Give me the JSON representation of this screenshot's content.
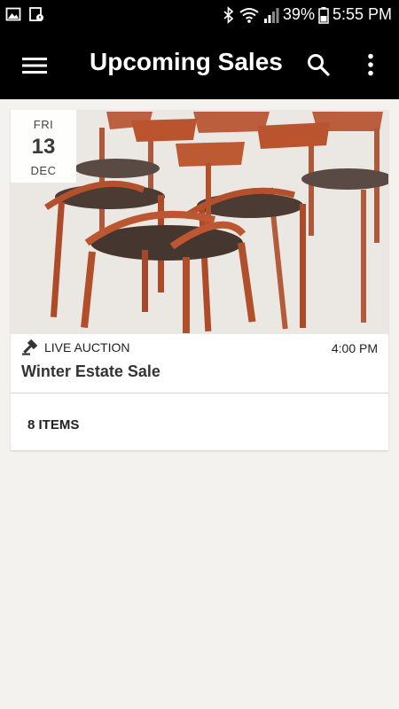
{
  "status_bar": {
    "battery": "39%",
    "time": "5:55 PM",
    "left_icons": [
      "image-icon",
      "calendar-notification-icon"
    ],
    "right_icons": [
      "bluetooth-icon",
      "wifi-icon",
      "signal-icon",
      "battery-icon"
    ]
  },
  "app_bar": {
    "title": "Upcoming Sales",
    "icons": [
      "menu-icon",
      "search-icon",
      "more-vert-icon"
    ]
  },
  "sales": [
    {
      "date": {
        "day_of_week": "FRI",
        "day": "13",
        "month": "DEC"
      },
      "type_label": "LIVE AUCTION",
      "type_icon": "gavel-icon",
      "time": "4:00 PM",
      "title": "Winter Estate Sale",
      "items_label": "8 ITEMS"
    }
  ],
  "colors": {
    "app_bar": "#000000",
    "background": "#f3f2ef",
    "card": "#ffffff",
    "text_dark": "#333333"
  }
}
